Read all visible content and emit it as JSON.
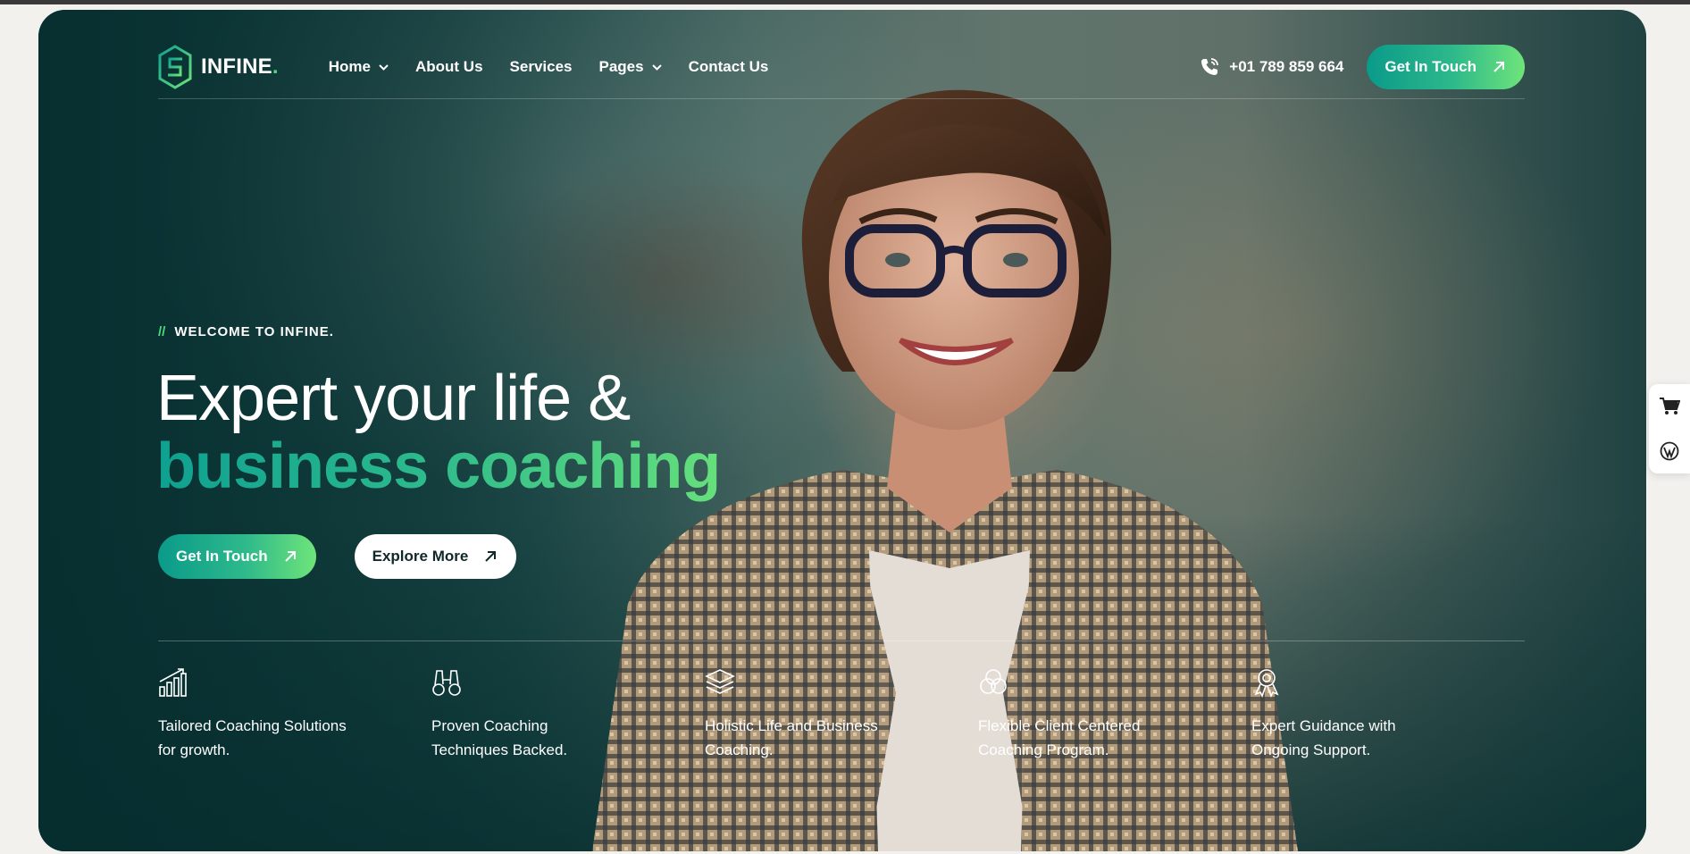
{
  "brand": {
    "name": "INFINE",
    "dot": ".",
    "accent": "#4ddc7b",
    "gradient": [
      "#0a9a8a",
      "#6ee47a"
    ]
  },
  "nav": {
    "items": [
      {
        "label": "Home",
        "dropdown": true
      },
      {
        "label": "About Us",
        "dropdown": false
      },
      {
        "label": "Services",
        "dropdown": false
      },
      {
        "label": "Pages",
        "dropdown": true
      },
      {
        "label": "Contact Us",
        "dropdown": false
      }
    ],
    "phone": "+01 789 859 664",
    "cta_label": "Get In Touch"
  },
  "hero": {
    "eyebrow_slash": "//",
    "eyebrow": "WELCOME TO INFINE.",
    "headline_line1": "Expert your life &",
    "headline_line2": "business coaching",
    "primary_cta": "Get In Touch",
    "secondary_cta": "Explore More"
  },
  "features": [
    {
      "icon": "growth-chart-icon",
      "text": "Tailored Coaching Solutions for growth."
    },
    {
      "icon": "binoculars-icon",
      "text": "Proven Coaching Techniques Backed."
    },
    {
      "icon": "layers-icon",
      "text": "Holistic Life and Business Coaching."
    },
    {
      "icon": "rings-icon",
      "text": "Flexible Client Centered Coaching Program."
    },
    {
      "icon": "award-icon",
      "text": "Expert Guidance with Ongoing Support."
    }
  ],
  "side_widget": {
    "icons": [
      "cart-icon",
      "wordpress-icon"
    ]
  }
}
